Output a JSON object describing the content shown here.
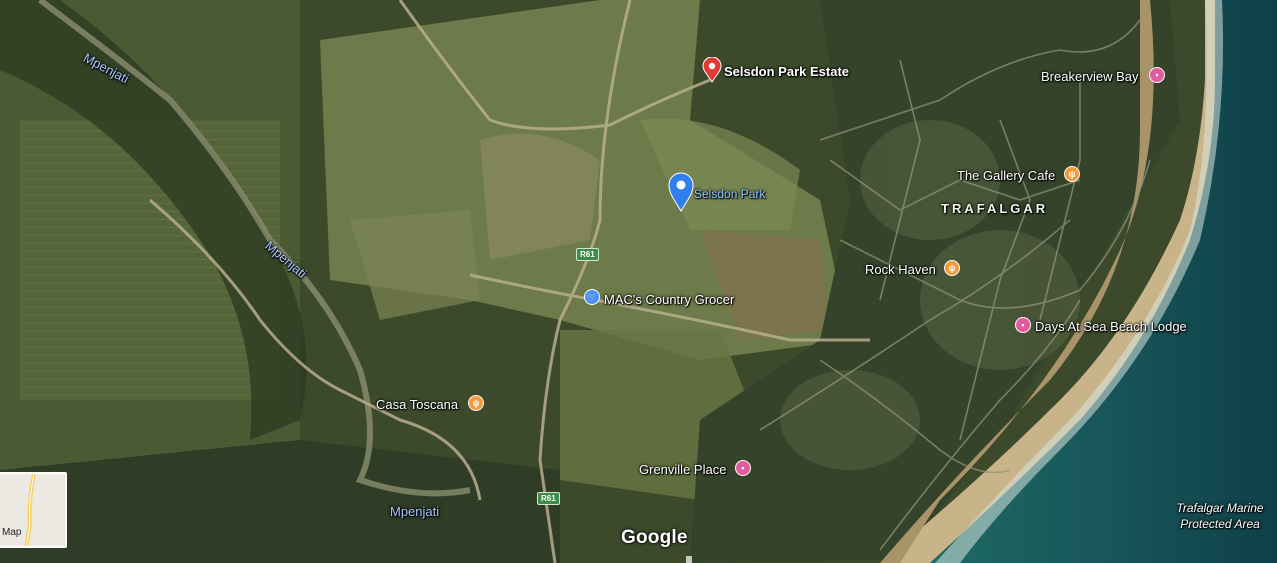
{
  "map": {
    "view": "satellite",
    "colors": {
      "pin_red": "#e53935",
      "pin_blue": "#2f80ed",
      "poi_orange": "#f39a3c",
      "poi_pink": "#e15b9d"
    }
  },
  "places": {
    "selsdon_park_estate": "Selsdon Park Estate",
    "selsdon_park": "Selsdon Park",
    "breakerview_bay": "Breakerview Bay",
    "gallery_cafe": "The Gallery Cafe",
    "trafalgar": "TRAFALGAR",
    "rock_haven": "Rock Haven",
    "days_at_sea": "Days At Sea Beach Lodge",
    "macs_grocer": "MAC's Country Grocer",
    "casa_toscana": "Casa Toscana",
    "grenville_place": "Grenville Place",
    "mpenjati_north": "Mpenjati",
    "mpenjati_mid": "Mpenjati",
    "mpenjati_south": "Mpenjati",
    "marine_area": "Trafalgar Marine Protected Area"
  },
  "roads": {
    "r61_north": "R61",
    "r61_south": "R61"
  },
  "controls": {
    "minimap_label": "Map"
  },
  "branding": {
    "logo": "Google"
  }
}
